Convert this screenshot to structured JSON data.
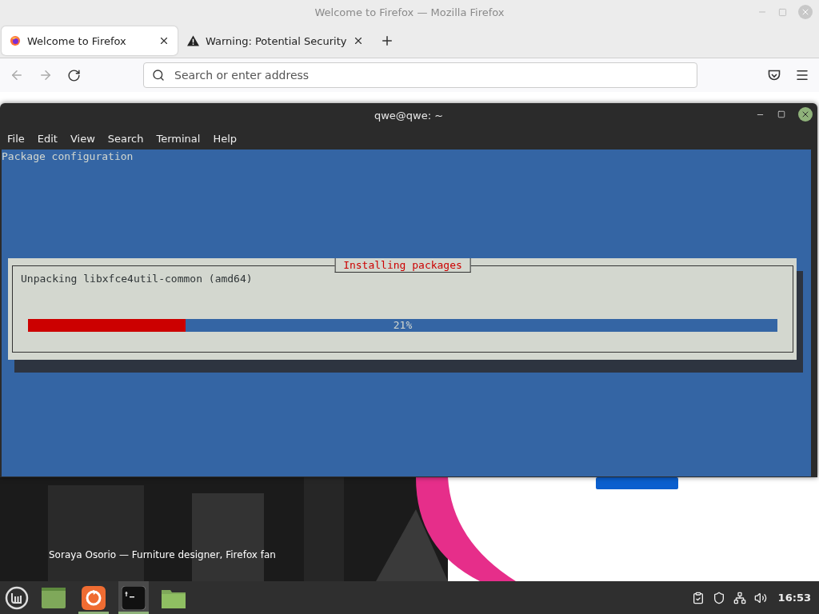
{
  "browser": {
    "title": "Welcome to Firefox — Mozilla Firefox",
    "tabs": [
      {
        "label": "Welcome to Firefox",
        "selected": true,
        "kind": "firefox"
      },
      {
        "label": "Warning: Potential Security",
        "selected": false,
        "kind": "warning"
      }
    ],
    "address": {
      "placeholder": "Search or enter address"
    }
  },
  "page": {
    "caption": "Soraya Osorio — Furniture designer, Firefox fan"
  },
  "terminal": {
    "title": "qwe@qwe: ~",
    "menu": [
      "File",
      "Edit",
      "View",
      "Search",
      "Terminal",
      "Help"
    ],
    "header": "Package configuration",
    "dialog": {
      "title": "Installing packages",
      "message": "Unpacking libxfce4util-common (amd64)",
      "progress": {
        "level": 0.21,
        "reading": "21%"
      }
    }
  },
  "taskbar": {
    "apps": [
      {
        "kind": "desktop",
        "selected": false,
        "running": false
      },
      {
        "kind": "firefox",
        "selected": false,
        "running": true
      },
      {
        "kind": "terminal",
        "selected": true,
        "running": true
      },
      {
        "kind": "files",
        "selected": false,
        "running": false
      }
    ],
    "clock": "16:53"
  }
}
